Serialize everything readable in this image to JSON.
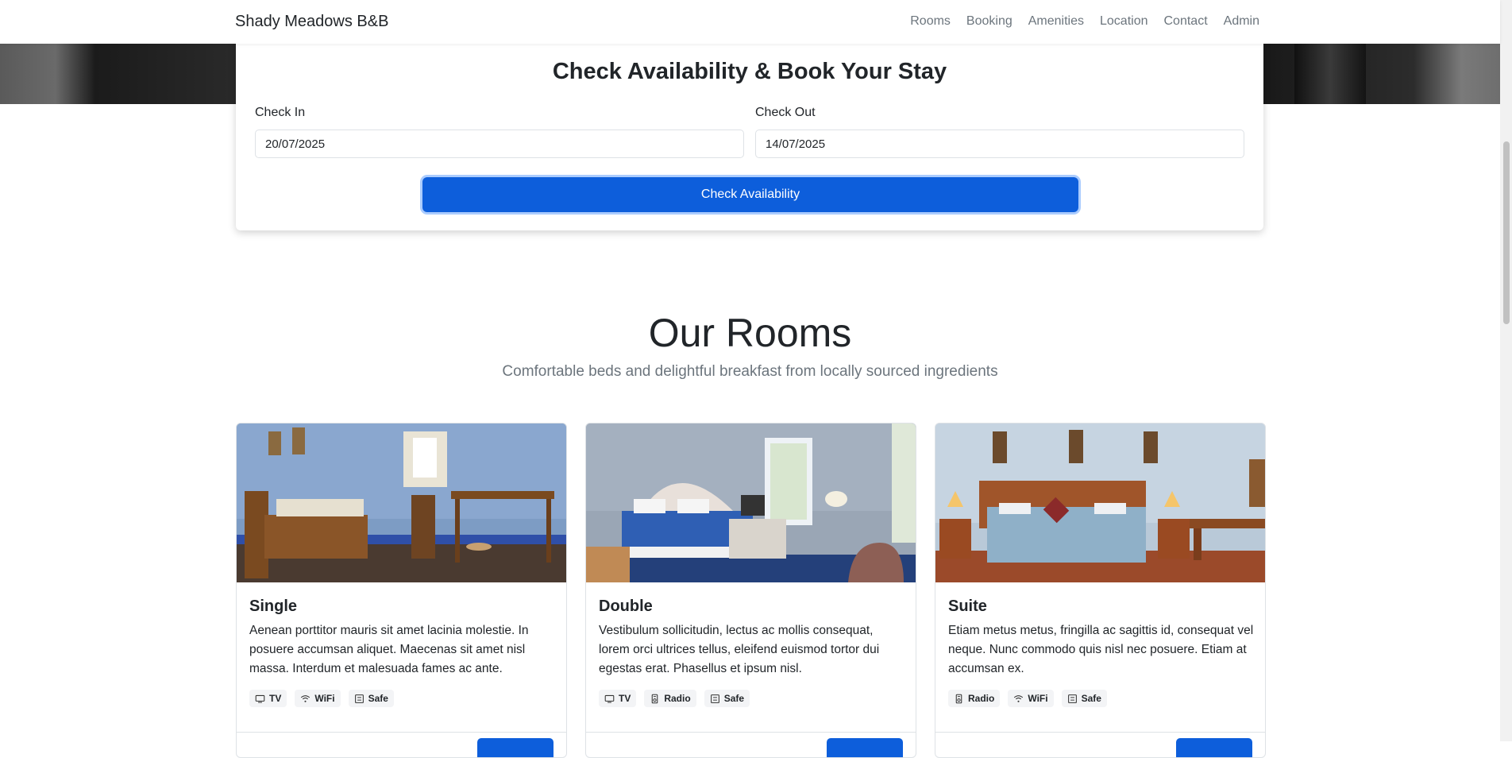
{
  "navbar": {
    "brand": "Shady Meadows B&B",
    "links": [
      "Rooms",
      "Booking",
      "Amenities",
      "Location",
      "Contact",
      "Admin"
    ]
  },
  "booking": {
    "title": "Check Availability & Book Your Stay",
    "check_in_label": "Check In",
    "check_in_value": "20/07/2025",
    "check_out_label": "Check Out",
    "check_out_value": "14/07/2025",
    "button_label": "Check Availability"
  },
  "rooms_section": {
    "title": "Our Rooms",
    "subtitle": "Comfortable beds and delightful breakfast from locally sourced ingredients"
  },
  "rooms": [
    {
      "name": "Single",
      "description": "Aenean porttitor mauris sit amet lacinia molestie. In posuere accumsan aliquet. Maecenas sit amet nisl massa. Interdum et malesuada fames ac ante.",
      "amenities": [
        {
          "label": "TV",
          "icon": "tv-icon"
        },
        {
          "label": "WiFi",
          "icon": "wifi-icon"
        },
        {
          "label": "Safe",
          "icon": "safe-icon"
        }
      ]
    },
    {
      "name": "Double",
      "description": "Vestibulum sollicitudin, lectus ac mollis consequat, lorem orci ultrices tellus, eleifend euismod tortor dui egestas erat. Phasellus et ipsum nisl.",
      "amenities": [
        {
          "label": "TV",
          "icon": "tv-icon"
        },
        {
          "label": "Radio",
          "icon": "radio-icon"
        },
        {
          "label": "Safe",
          "icon": "safe-icon"
        }
      ]
    },
    {
      "name": "Suite",
      "description": "Etiam metus metus, fringilla ac sagittis id, consequat vel neque. Nunc commodo quis nisl nec posuere. Etiam at accumsan ex.",
      "amenities": [
        {
          "label": "Radio",
          "icon": "radio-icon"
        },
        {
          "label": "WiFi",
          "icon": "wifi-icon"
        },
        {
          "label": "Safe",
          "icon": "safe-icon"
        }
      ]
    }
  ],
  "colors": {
    "primary": "#0d5edb",
    "muted_text": "#6c757d",
    "text": "#212529"
  }
}
